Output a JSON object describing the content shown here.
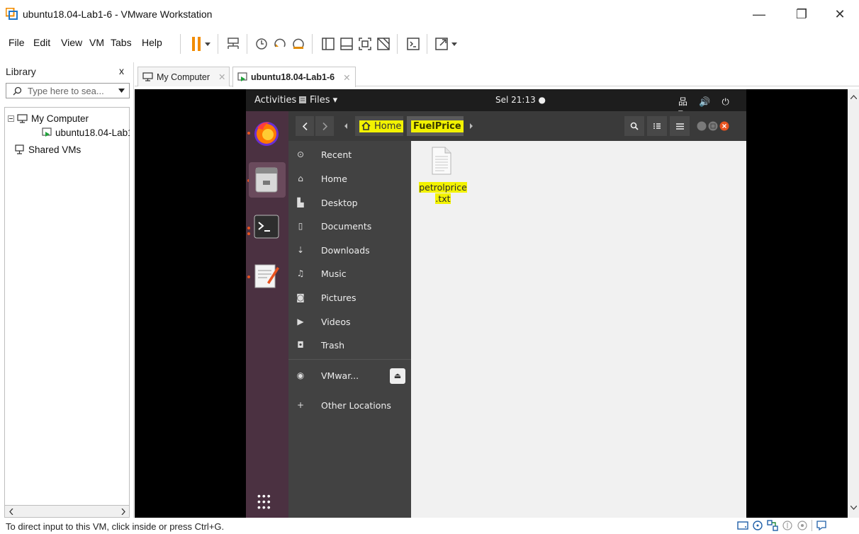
{
  "window": {
    "title": "ubuntu18.04-Lab1-6 - VMware Workstation",
    "minimize": "—",
    "maximize": "❐",
    "close": "✕"
  },
  "menu": [
    "File",
    "Edit",
    "View",
    "VM",
    "Tabs",
    "Help"
  ],
  "library": {
    "title": "Library",
    "close": "x",
    "search_placeholder": "Type here to sea...",
    "tree": {
      "my_computer": "My Computer",
      "vm": "ubuntu18.04-Lab1",
      "shared": "Shared VMs"
    }
  },
  "tabs": [
    {
      "label": "My Computer",
      "close": "✕"
    },
    {
      "label": "ubuntu18.04-Lab1-6",
      "close": "✕"
    }
  ],
  "ubuntu": {
    "activities": "Activities",
    "files_menu": "Files ▾",
    "clock": "Sel 21:13 ●",
    "tray": "品 🔊 ⏻ ▾",
    "breadcrumb": {
      "home": "Home",
      "current": "FuelPrice"
    },
    "sidebar": [
      {
        "label": "Recent",
        "icon": "clock-icon"
      },
      {
        "label": "Home",
        "icon": "home-icon"
      },
      {
        "label": "Desktop",
        "icon": "folder-icon"
      },
      {
        "label": "Documents",
        "icon": "document-icon"
      },
      {
        "label": "Downloads",
        "icon": "download-icon"
      },
      {
        "label": "Music",
        "icon": "music-icon"
      },
      {
        "label": "Pictures",
        "icon": "camera-icon"
      },
      {
        "label": "Videos",
        "icon": "video-icon"
      },
      {
        "label": "Trash",
        "icon": "trash-icon"
      },
      {
        "label": "VMwar...",
        "icon": "disc-icon"
      },
      {
        "label": "Other Locations",
        "icon": "plus-icon"
      }
    ],
    "file": {
      "name_line1": "petrolprice",
      "name_line2": ".txt"
    }
  },
  "status": {
    "text": "To direct input to this VM, click inside or press Ctrl+G."
  },
  "colors": {
    "ubuntu_orange": "#e95420",
    "dock": "#4b3141",
    "highlight": "#f2f200"
  }
}
